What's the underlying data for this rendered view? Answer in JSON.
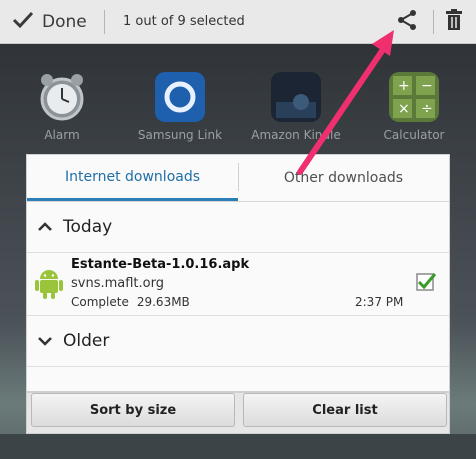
{
  "actionbar": {
    "done_label": "Done",
    "selection_text": "1 out of 9 selected"
  },
  "home_apps": [
    {
      "name": "Alarm"
    },
    {
      "name": "Samsung Link"
    },
    {
      "name": "Amazon Kindle"
    },
    {
      "name": "Calculator"
    }
  ],
  "dialog": {
    "tabs": [
      {
        "label": "Internet downloads",
        "active": true
      },
      {
        "label": "Other downloads",
        "active": false
      }
    ],
    "groups": {
      "today": "Today",
      "older": "Older"
    },
    "download": {
      "filename": "Estante-Beta-1.0.16.apk",
      "source": "svns.maflt.org",
      "status": "Complete",
      "size": "29.63MB",
      "time": "2:37 PM",
      "checked": true
    }
  },
  "bottom_buttons": {
    "sort": "Sort by size",
    "clear": "Clear list"
  },
  "colors": {
    "accent": "#2a7fb6",
    "annotation_arrow": "#f0306e",
    "android_green": "#9ac53a"
  }
}
